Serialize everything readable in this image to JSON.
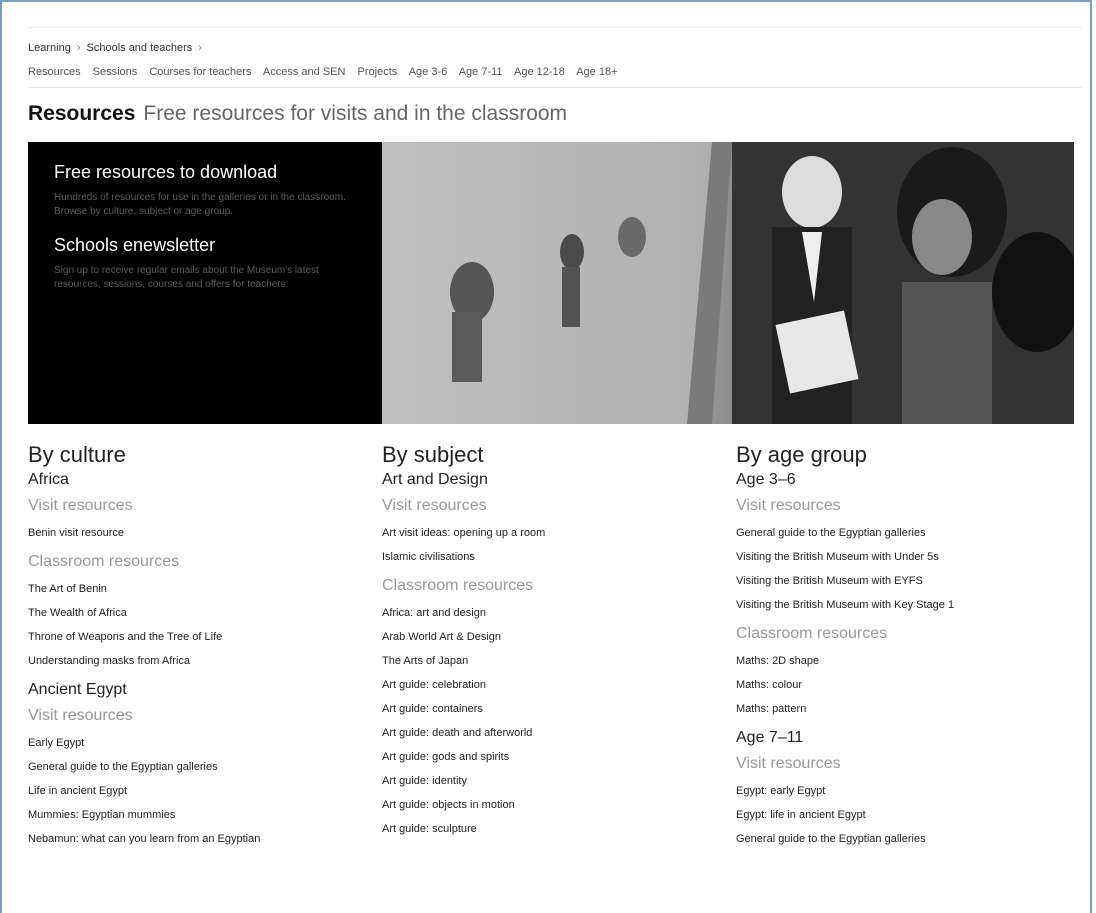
{
  "breadcrumb": [
    "Learning",
    "Schools and teachers"
  ],
  "subnav": [
    "Resources",
    "Sessions",
    "Courses for teachers",
    "Access and SEN",
    "Projects",
    "Age 3-6",
    "Age 7-11",
    "Age 12-18",
    "Age 18+"
  ],
  "page_title": {
    "bold": "Resources",
    "subtitle": "Free resources for visits and in the classroom"
  },
  "hero": {
    "download_title": "Free resources to download",
    "download_text": "Hundreds of resources for use in the galleries or in the classroom. Browse by culture, subject or age group.",
    "newsletter_title": "Schools enewsletter",
    "newsletter_text": "Sign up to receive regular emails about the Museum's latest resources, sessions, courses and offers for teachers."
  },
  "culture": {
    "title": "By culture",
    "africa": {
      "name": "Africa",
      "visit_label": "Visit resources",
      "visit": [
        "Benin visit resource"
      ],
      "classroom_label": "Classroom resources",
      "classroom": [
        "The Art of Benin",
        "The Wealth of Africa",
        "Throne of Weapons and the Tree of Life",
        "Understanding masks from Africa"
      ]
    },
    "egypt": {
      "name": "Ancient Egypt",
      "visit_label": "Visit resources",
      "visit": [
        "Early Egypt",
        "General guide to the Egyptian galleries",
        "Life in ancient Egypt",
        "Mummies: Egyptian mummies",
        "Nebamun: what can you learn from an Egyptian"
      ]
    }
  },
  "subject": {
    "title": "By subject",
    "art": {
      "name": "Art and Design",
      "visit_label": "Visit resources",
      "visit": [
        "Art visit ideas: opening up a room",
        "Islamic civilisations"
      ],
      "classroom_label": "Classroom resources",
      "classroom": [
        "Africa: art and design",
        "Arab World Art & Design",
        "The Arts of Japan",
        "Art guide: celebration",
        "Art guide: containers",
        "Art guide: death and afterworld",
        "Art guide: gods and spirits",
        "Art guide: identity",
        "Art guide: objects in motion",
        "Art guide: sculpture"
      ]
    }
  },
  "age": {
    "title": "By age group",
    "a36": {
      "name": "Age 3–6",
      "visit_label": "Visit resources",
      "visit": [
        "General guide to the Egyptian galleries",
        "Visiting the British Museum with Under 5s",
        "Visiting the British Museum with EYFS",
        "Visiting the British Museum with Key Stage 1"
      ],
      "classroom_label": "Classroom resources",
      "classroom": [
        "Maths: 2D shape",
        "Maths: colour",
        "Maths: pattern"
      ]
    },
    "a711": {
      "name": "Age 7–11",
      "visit_label": "Visit resources",
      "visit": [
        "Egypt: early Egypt",
        "Egypt: life in ancient Egypt",
        "General guide to the Egyptian galleries"
      ]
    }
  }
}
